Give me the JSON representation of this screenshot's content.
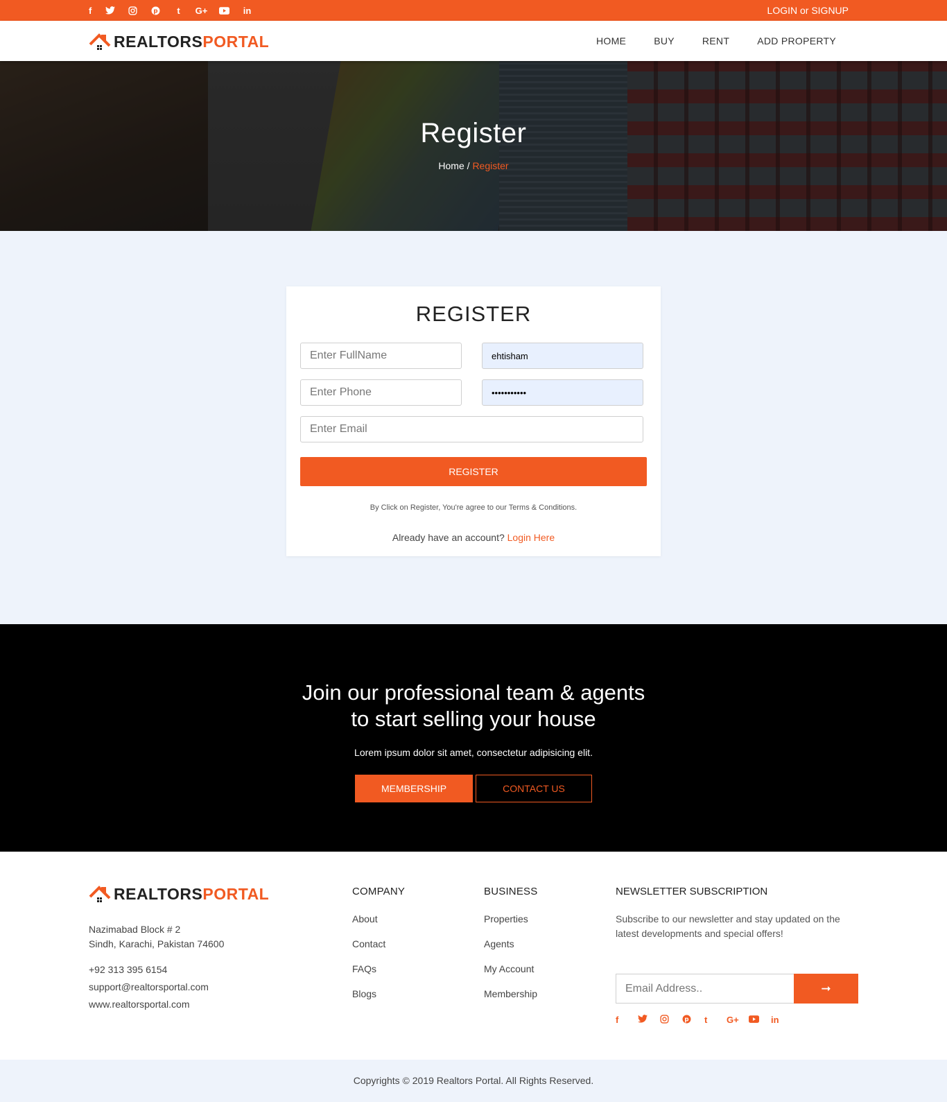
{
  "topbar": {
    "social_icons": [
      "facebook-icon",
      "twitter-icon",
      "instagram-icon",
      "pinterest-icon",
      "tumblr-icon",
      "google-plus-icon",
      "youtube-icon",
      "linkedin-icon"
    ],
    "social_glyphs": [
      "f",
      "🐦",
      "◎",
      "℗",
      "t",
      "G+",
      "▶",
      "in"
    ],
    "login": "LOGIN or SIGNUP"
  },
  "brand": {
    "part1": "REALTORS",
    "part2": "PORTAL",
    "accent": "#f15a22"
  },
  "nav": {
    "items": [
      "HOME",
      "BUY",
      "RENT",
      "ADD PROPERTY"
    ]
  },
  "hero": {
    "title": "Register",
    "crumb_home": "Home",
    "crumb_sep": " / ",
    "crumb_current": "Register"
  },
  "register": {
    "title": "REGISTER",
    "fullname_placeholder": "Enter FullName",
    "username_value": "ehtisham",
    "phone_placeholder": "Enter Phone",
    "password_value": "password123",
    "email_placeholder": "Enter Email",
    "button": "REGISTER",
    "terms": "By Click on Register, You're agree to our Terms & Conditions.",
    "already": "Already have an account?",
    "login_link": "Login Here"
  },
  "join": {
    "title_line1": "Join our professional team & agents",
    "title_line2": "to start selling your house",
    "text": "Lorem ipsum dolor sit amet, consectetur adipisicing elit.",
    "membership": "MEMBERSHIP",
    "contact": "CONTACT US"
  },
  "footer": {
    "address_line1": "Nazimabad Block # 2",
    "address_line2": "Sindh, Karachi, Pakistan 74600",
    "phone": "+92 313 395 6154",
    "email": "support@realtorsportal.com",
    "website": "www.realtorsportal.com",
    "company": {
      "heading": "COMPANY",
      "links": [
        "About",
        "Contact",
        "FAQs",
        "Blogs"
      ]
    },
    "business": {
      "heading": "BUSINESS",
      "links": [
        "Properties",
        "Agents",
        "My Account",
        "Membership"
      ]
    },
    "newsletter": {
      "heading": "NEWSLETTER SUBSCRIPTION",
      "text": "Subscribe to our newsletter and stay updated on the latest developments and special offers!",
      "placeholder": "Email Address..",
      "button": "➞"
    },
    "copyright": "Copyrights © 2019 Realtors Portal. All Rights Reserved."
  }
}
